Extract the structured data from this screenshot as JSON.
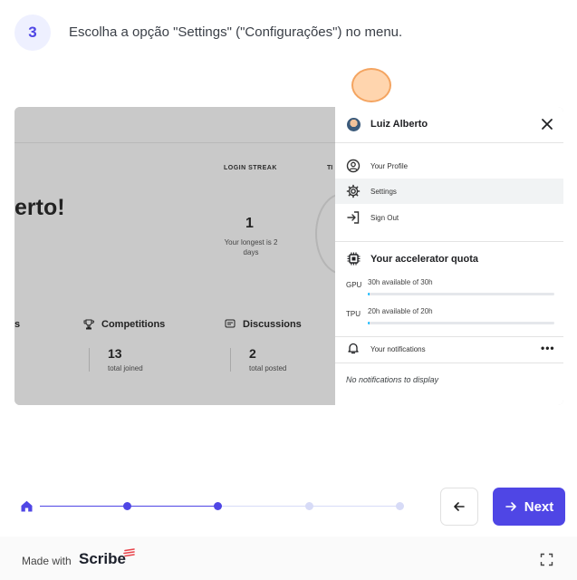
{
  "step": {
    "number": "3",
    "instruction": "Escolha a opção \"Settings\" (\"Configurações\") no menu."
  },
  "screenshot": {
    "greeting": "erto!",
    "login_streak": {
      "label": "LOGIN STREAK",
      "value": "1",
      "sub": "Your longest is 2 days"
    },
    "ti_label": "TI",
    "partial_stat": "s",
    "competitions": {
      "title": "Competitions",
      "value": "13",
      "sub": "total joined"
    },
    "discussions": {
      "title": "Discussions",
      "value": "2",
      "sub": "total posted"
    }
  },
  "menu": {
    "user_name": "Luiz Alberto",
    "items": [
      {
        "label": "Your Profile",
        "icon": "user-circle-icon"
      },
      {
        "label": "Settings",
        "icon": "gear-icon"
      },
      {
        "label": "Sign Out",
        "icon": "sign-out-icon"
      }
    ],
    "quota": {
      "title": "Your accelerator quota",
      "gpu": {
        "key": "GPU",
        "desc": "30h available of 30h",
        "used_fraction": 0.01
      },
      "tpu": {
        "key": "TPU",
        "desc": "20h available of 20h",
        "used_fraction": 0.01
      }
    },
    "notifications": {
      "title": "Your notifications",
      "more": "•••",
      "empty": "No notifications to display"
    }
  },
  "nav": {
    "next_label": "Next",
    "colors": {
      "accent": "#4f46e5",
      "track_done": "#4f46e5",
      "track_todo": "#d7dbf7"
    }
  },
  "footer": {
    "made_with": "Made with",
    "brand": "Scribe"
  }
}
